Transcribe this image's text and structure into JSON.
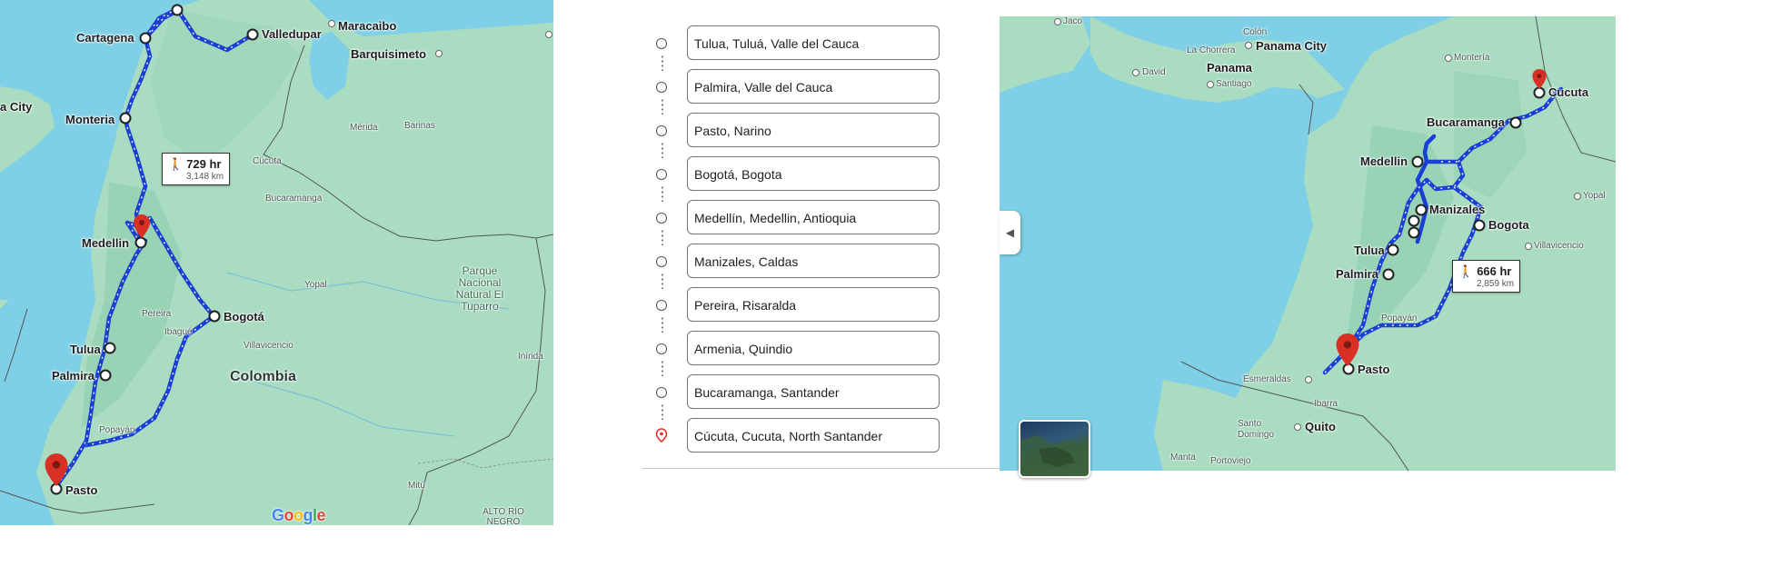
{
  "left_map": {
    "route_summary": {
      "duration": "729 hr",
      "distance": "3,148 km"
    },
    "stop_labels": {
      "cartagena": "Cartagena",
      "valledupar": "Valledupar",
      "monteria": "Monteria",
      "medellin": "Medellin",
      "bogota": "Bogotá",
      "tulua": "Tulua",
      "palmira": "Palmira",
      "pasto": "Pasto"
    },
    "place_labels": {
      "maracaibo": "Maracaibo",
      "barquisimeto": "Barquisimeto",
      "panama_city_partial": "a City",
      "merida": "Mérida",
      "barinas": "Barinas",
      "cucuta": "Cúcuta",
      "bucaramanga": "Bucaramanga",
      "yopal": "Yopal",
      "pereira": "Pereira",
      "ibague": "Ibagué",
      "villavicencio": "Villavicencio",
      "colombia": "Colombia",
      "inirida": "Inírida",
      "popayan": "Popayán",
      "mitu": "Mitú",
      "alto_rio_negro": "ALTO RÍO NEGRO",
      "park": "Parque Nacional Natural El Tuparro"
    },
    "logo": "Google"
  },
  "directions": {
    "waypoints": [
      "Tulua, Tuluá, Valle del Cauca",
      "Palmira, Valle del Cauca",
      "Pasto, Narino",
      "Bogotá, Bogota",
      "Medellín, Medellin, Antioquia",
      "Manizales, Caldas",
      "Pereira, Risaralda",
      "Armenia, Quindio",
      "Bucaramanga, Santander",
      "Cúcuta, Cucuta, North Santander"
    ],
    "collapse_icon": "chevron-left-icon"
  },
  "right_map": {
    "route_summary": {
      "duration": "666 hr",
      "distance": "2,859 km"
    },
    "stop_labels": {
      "cucuta": "Cucuta",
      "bucaramanga": "Bucaramanga",
      "medellin": "Medellin",
      "manizales": "Manizales",
      "bogota": "Bogota",
      "tulua": "Tulua",
      "palmira": "Palmira",
      "pasto": "Pasto"
    },
    "place_labels": {
      "jaco": "Jaco",
      "colon": "Colón",
      "panama_city": "Panama City",
      "la_chorrera": "La Chorrera",
      "panama": "Panama",
      "santiago": "Santiago",
      "david": "David",
      "monteria": "Montería",
      "yopal": "Yopal",
      "villavicencio": "Villavicencio",
      "popayan": "Popayán",
      "esmeraldas": "Esmeraldas",
      "ibarra": "Ibarra",
      "santo_domingo": "Santo Domingo",
      "quito": "Quito",
      "manta": "Manta",
      "portoviejo": "Portoviejo"
    },
    "layer_toggle_icon": "satellite-layer-icon"
  },
  "colors": {
    "water": "#7fd0e6",
    "land": "#a9dcc1",
    "route": "#1a3fd4",
    "pin": "#d93025"
  }
}
